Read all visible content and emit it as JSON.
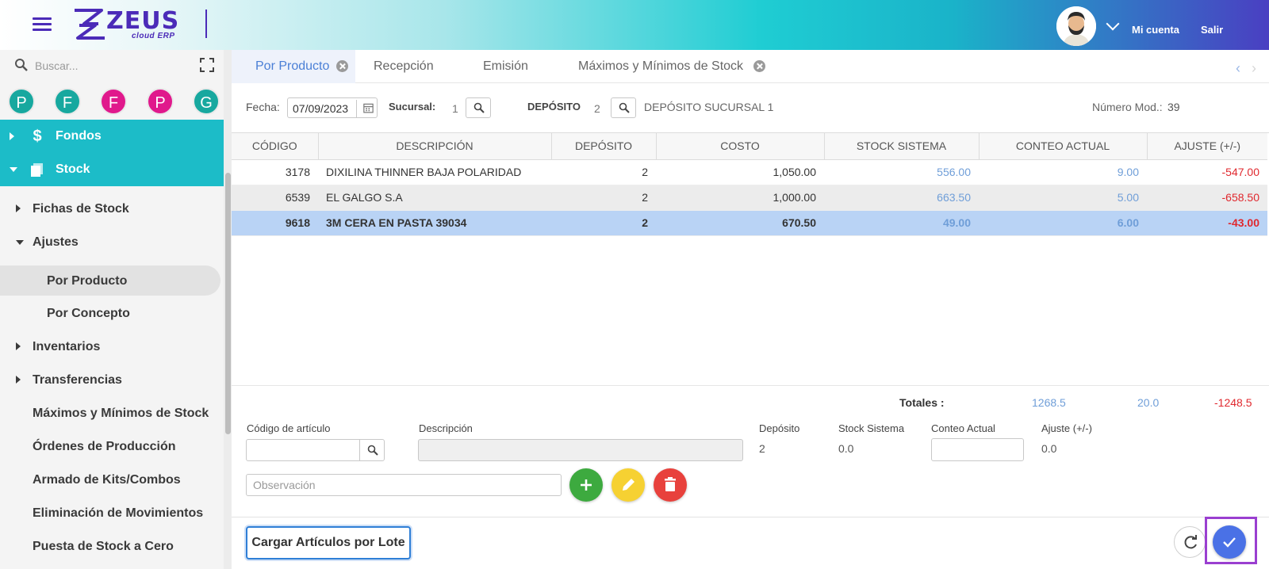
{
  "header": {
    "logo_text": "ZEUS",
    "logo_sub": "cloud ERP",
    "account_label": "Mi cuenta",
    "logout_label": "Salir",
    "icons": {
      "menu": "hamburger-icon",
      "avatar": "avatar",
      "chevron": "chevron-down-icon"
    }
  },
  "sidebar": {
    "search_placeholder": "Buscar...",
    "shortcuts": [
      {
        "letter": "P",
        "color": "#17a89f"
      },
      {
        "letter": "F",
        "color": "#17a89f"
      },
      {
        "letter": "F",
        "color": "#e0198c"
      },
      {
        "letter": "P",
        "color": "#e0198c"
      },
      {
        "letter": "G",
        "color": "#17a89f"
      }
    ],
    "modules": [
      {
        "label": "Fondos",
        "icon": "$"
      },
      {
        "label": "Stock",
        "icon": "▢"
      }
    ],
    "items": [
      {
        "label": "Fichas de Stock"
      },
      {
        "label": "Ajustes"
      },
      {
        "label": "Por Producto"
      },
      {
        "label": "Por Concepto"
      },
      {
        "label": "Inventarios"
      },
      {
        "label": "Transferencias"
      },
      {
        "label": "Máximos y Mínimos de Stock"
      },
      {
        "label": "Órdenes de Producción"
      },
      {
        "label": "Armado de Kits/Combos"
      },
      {
        "label": "Eliminación de Movimientos"
      },
      {
        "label": "Puesta de Stock a Cero"
      }
    ]
  },
  "tabs": [
    {
      "label": "Por Producto"
    },
    {
      "label": "Recepción"
    },
    {
      "label": "Emisión"
    },
    {
      "label": "Máximos y Mínimos de Stock"
    }
  ],
  "filter": {
    "fecha_label": "Fecha:",
    "fecha_value": "07/09/2023",
    "sucursal_label": "Sucursal:",
    "sucursal_value": "1",
    "deposito_label": "DEPÓSITO",
    "deposito_value": "2",
    "deposito_name": "DEPÓSITO SUCURSAL 1",
    "numero_label": "Número Mod.:",
    "numero_value": "39"
  },
  "table": {
    "columns": [
      "CÓDIGO",
      "DESCRIPCIÓN",
      "DEPÓSITO",
      "COSTO",
      "STOCK SISTEMA",
      "CONTEO ACTUAL",
      "AJUSTE (+/-)"
    ],
    "rows": [
      {
        "codigo": "3178",
        "descripcion": "DIXILINA THINNER BAJA POLARIDAD",
        "deposito": "2",
        "costo": "1,050.00",
        "stock": "556.00",
        "conteo": "9.00",
        "ajuste": "-547.00"
      },
      {
        "codigo": "6539",
        "descripcion": "EL GALGO S.A",
        "deposito": "2",
        "costo": "1,000.00",
        "stock": "663.50",
        "conteo": "5.00",
        "ajuste": "-658.50"
      },
      {
        "codigo": "9618",
        "descripcion": "3M CERA EN PASTA 39034",
        "deposito": "2",
        "costo": "670.50",
        "stock": "49.00",
        "conteo": "6.00",
        "ajuste": "-43.00"
      }
    ]
  },
  "totals": {
    "label": "Totales :",
    "stock": "1268.5",
    "conteo": "20.0",
    "ajuste": "-1248.5"
  },
  "form": {
    "codigo_label": "Código de artículo",
    "descripcion_label": "Descripción",
    "deposito_label": "Depósito",
    "deposito_value": "2",
    "stock_label": "Stock Sistema",
    "stock_value": "0.0",
    "conteo_label": "Conteo Actual",
    "ajuste_label": "Ajuste (+/-)",
    "ajuste_value": "0.0",
    "observacion_placeholder": "Observación"
  },
  "footer": {
    "lote_label": "Cargar Artículos por Lote"
  },
  "colors": {
    "accent": "#1cbcc8",
    "primary": "#4a71e6",
    "add": "#3daa3f",
    "edit": "#f6d132",
    "delete": "#e8413c"
  }
}
